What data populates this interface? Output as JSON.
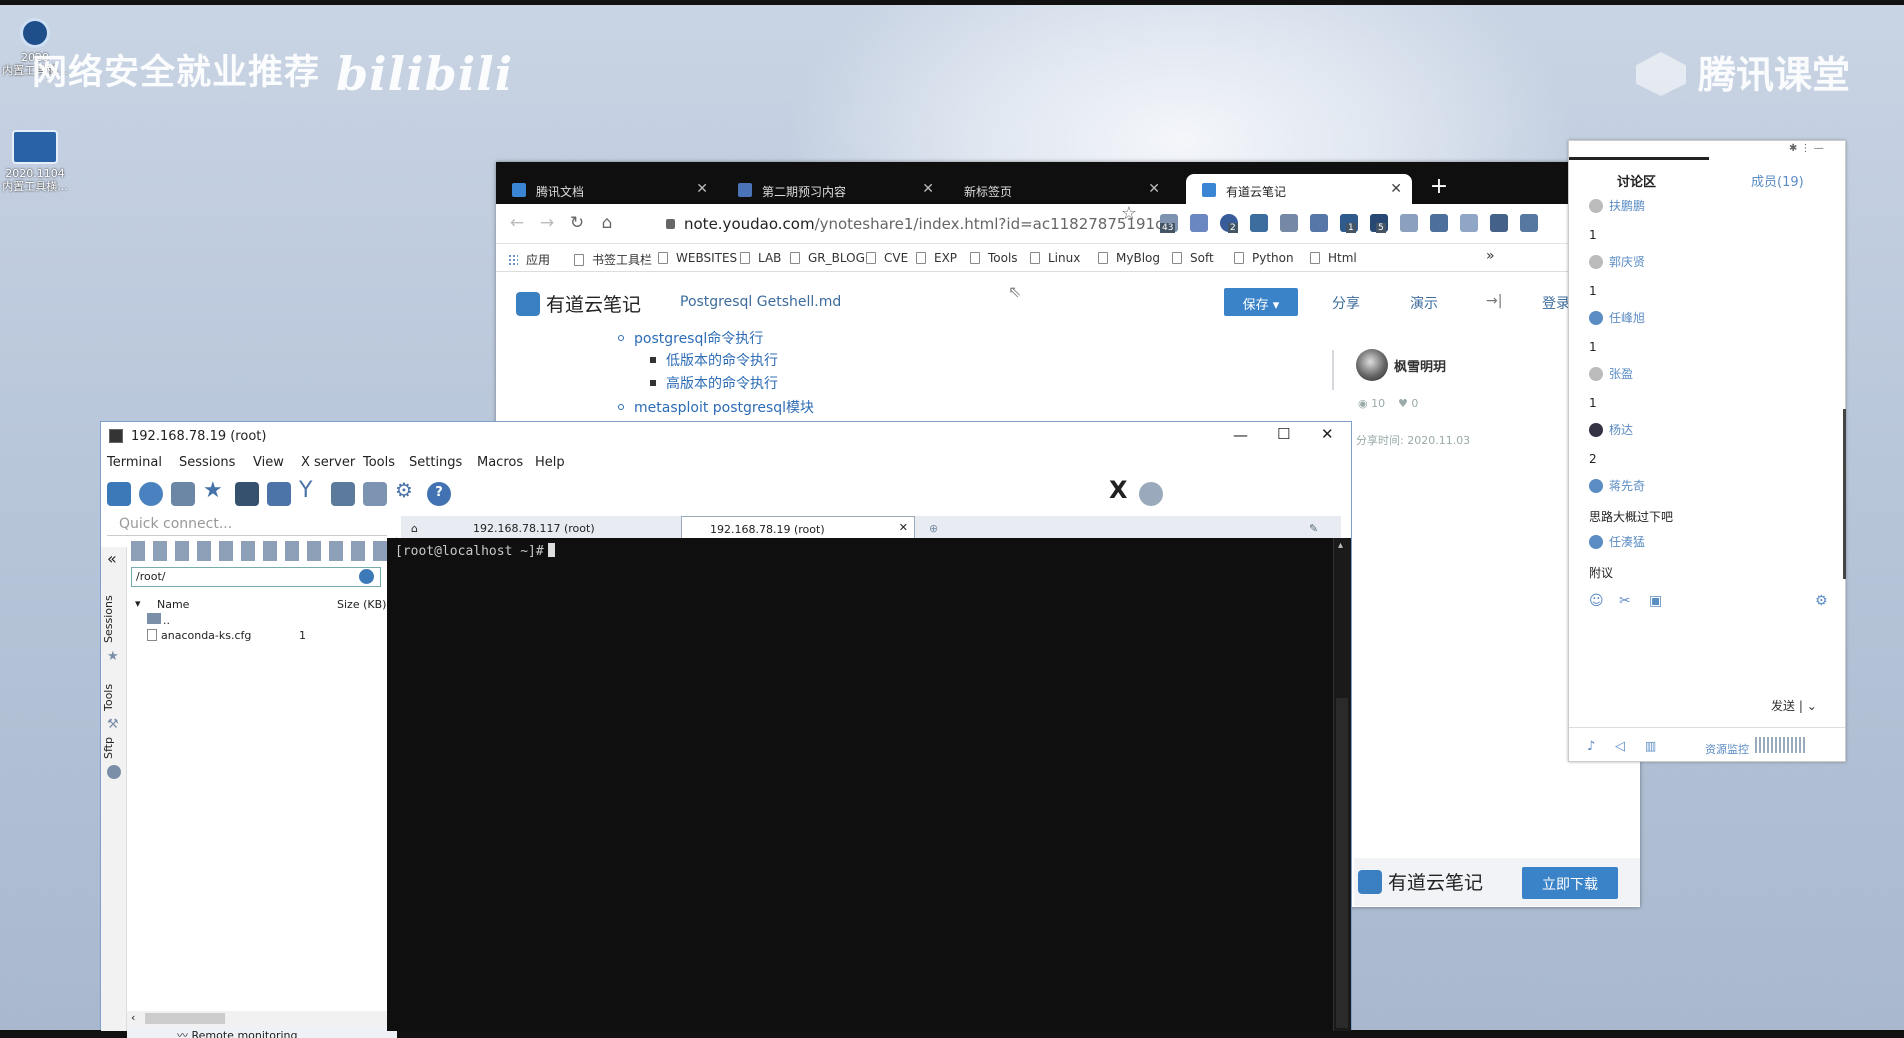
{
  "desktop": {
    "icons": [
      {
        "label_top": "2020",
        "label_bottom": "内置工具横..."
      },
      {
        "label_top": "2020.1104",
        "label_bottom": "内置工具横..."
      }
    ],
    "watermark_left": "网络安全就业推荐",
    "watermark_left_logo": "bilibili",
    "watermark_right": "腾讯课堂"
  },
  "browser": {
    "tabs": [
      {
        "label": "腾讯文档"
      },
      {
        "label": "第二期预习内容"
      },
      {
        "label": "新标签页"
      },
      {
        "label": "有道云笔记"
      }
    ],
    "new_tab": "+",
    "url_domain": "note.youdao.com",
    "url_path": "/ynoteshare1/index.html?id=ac11827875191c...",
    "ext_badges": [
      "43",
      "2",
      "1",
      "5"
    ],
    "bookmarks": [
      "应用",
      "书签工具栏",
      "WEBSITES",
      "LAB",
      "GR_BLOG",
      "CVE",
      "EXP",
      "Tools",
      "Linux",
      "MyBlog",
      "Soft",
      "Python",
      "Html"
    ],
    "bookmarks_more": "»"
  },
  "youdao": {
    "logo": "有道云笔记",
    "doc_title": "Postgresql Getshell.md",
    "save": "保存",
    "share": "分享",
    "present": "演示",
    "login": "登录 /",
    "outline": [
      {
        "level": 1,
        "text": "postgresql命令执行"
      },
      {
        "level": 2,
        "text": "低版本的命令执行"
      },
      {
        "level": 2,
        "text": "高版本的命令执行"
      },
      {
        "level": 1,
        "text": "metasploit postgresql模块"
      }
    ],
    "author": "枫雪明玥",
    "views": "10",
    "likes": "0",
    "share_time": "分享时间: 2020.11.03",
    "footer_logo": "有道云笔记",
    "download": "立即下载"
  },
  "discussion": {
    "tab_discuss": "讨论区",
    "tab_members": "成员(19)",
    "messages": [
      {
        "name": "扶鹏鹏",
        "text": "1"
      },
      {
        "name": "郭庆贤",
        "text": "1"
      },
      {
        "name": "任峰旭",
        "text": "1"
      },
      {
        "name": "张盈",
        "text": "1"
      },
      {
        "name": "杨达",
        "text": "2"
      },
      {
        "name": "蒋先奇",
        "text": "思路大概过下吧"
      },
      {
        "name": "任湊猛",
        "text": "附议"
      }
    ],
    "send": "发送",
    "resource_monitor": "资源监控"
  },
  "moba": {
    "title": "192.168.78.19 (root)",
    "menu": [
      "Terminal",
      "Sessions",
      "View",
      "X server",
      "Tools",
      "Settings",
      "Macros",
      "Help"
    ],
    "quick_connect": "Quick connect...",
    "rail": [
      "Sessions",
      "Tools",
      "Sftp"
    ],
    "path": "/root/",
    "col_name": "Name",
    "col_size": "Size (KB)",
    "files": [
      {
        "name": "..",
        "size": ""
      },
      {
        "name": "anaconda-ks.cfg",
        "size": "1"
      }
    ],
    "tabs": [
      {
        "label": "192.168.78.117 (root)"
      },
      {
        "label": "192.168.78.19 (root)"
      }
    ],
    "prompt": "[root@localhost ~]#",
    "remote_monitoring": "Remote monitoring"
  }
}
